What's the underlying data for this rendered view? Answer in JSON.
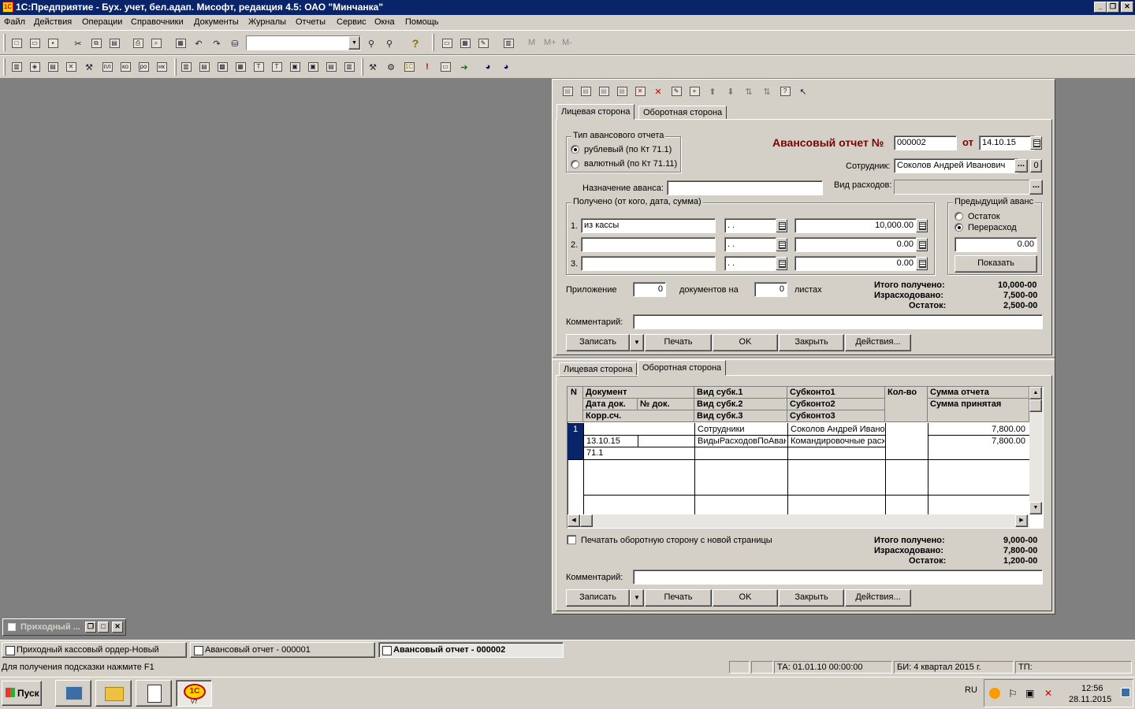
{
  "window": {
    "title": "1С:Предприятие - Бух. учет, бел.адап. Мисофт, редакция 4.5: ОАО \"Минчанка\""
  },
  "menu": [
    "Файл",
    "Действия",
    "Операции",
    "Справочники",
    "Документы",
    "Журналы",
    "Отчеты",
    "Сервис",
    "Окна",
    "Помощь"
  ],
  "toolbar": {
    "m_labels": [
      "M",
      "M+",
      "M-"
    ]
  },
  "tabs": {
    "front": "Лицевая сторона",
    "back": "Оборотная сторона"
  },
  "front": {
    "report_type": {
      "caption": "Тип авансового отчета",
      "opt1": "рублевый (по Кт 71.1)",
      "opt2": "валютный (по Кт 71.11)"
    },
    "heading": "Авансовый отчет №",
    "number": "000002",
    "from_label": "от",
    "date": "14.10.15",
    "employee_label": "Сотрудник:",
    "employee": "Соколов Андрей Иванович",
    "purpose_label": "Назначение аванса:",
    "purpose": "",
    "expense_type_label": "Вид расходов:",
    "expense_type": "",
    "received": {
      "caption": "Получено (от кого, дата, сумма)",
      "rows": [
        {
          "n": "1.",
          "from": "из кассы",
          "date": " .  .",
          "sum": "10,000.00"
        },
        {
          "n": "2.",
          "from": "",
          "date": " .  .",
          "sum": "0.00"
        },
        {
          "n": "3.",
          "from": "",
          "date": " .  .",
          "sum": "0.00"
        }
      ]
    },
    "prev": {
      "caption": "Предыдущий аванс",
      "opt1": "Остаток",
      "opt2": "Перерасход",
      "value": "0.00",
      "show_btn": "Показать"
    },
    "attach_label": "Приложение",
    "attach_docs": "0",
    "docs_label": "документов на",
    "sheets": "0",
    "sheets_label": "листах",
    "totals": {
      "received_label": "Итого получено:",
      "received": "10,000-00",
      "spent_label": "Израсходовано:",
      "spent": "7,500-00",
      "rest_label": "Остаток:",
      "rest": "2,500-00"
    },
    "comment_label": "Комментарий:",
    "comment": ""
  },
  "buttons": {
    "save": "Записать",
    "print": "Печать",
    "ok": "OK",
    "close": "Закрыть",
    "actions": "Действия..."
  },
  "back": {
    "headers": {
      "n": "N",
      "doc": "Документ",
      "doc_date": "Дата док.",
      "doc_no": "№ док.",
      "corr": "Корр.сч.",
      "sub1": "Вид субк.1",
      "sub2": "Вид субк.2",
      "sub3": "Вид субк.3",
      "subk1": "Субконто1",
      "subk2": "Субконто2",
      "subk3": "Субконто3",
      "qty": "Кол-во",
      "sum_report": "Сумма отчета",
      "sum_accepted": "Сумма принятая"
    },
    "row": {
      "n": "1",
      "doc": "",
      "date": "13.10.15",
      "no": "",
      "corr": "71.1",
      "sub1": "Сотрудники",
      "sub2": "ВидыРасходовПоАвансОтчетам",
      "sub3": "",
      "subk1": "Соколов Андрей Иванович",
      "subk2": "Командировочные расходы",
      "subk3": "",
      "qty": "",
      "sum_report": "7,800.00",
      "sum_accepted": "7,800.00"
    },
    "print_new_page": "Печатать оборотную сторону с новой страницы",
    "totals": {
      "received_label": "Итого получено:",
      "received": "9,000-00",
      "spent_label": "Израсходовано:",
      "spent": "7,800-00",
      "rest_label": "Остаток:",
      "rest": "1,200-00"
    },
    "comment_label": "Комментарий:",
    "comment": ""
  },
  "minimized": {
    "title": "Приходный ..."
  },
  "window_list": [
    "Приходный кассовый ордер-Новый",
    "Авансовый отчет - 000001",
    "Авансовый отчет - 000002"
  ],
  "status": {
    "hint": "Для получения подсказки нажмите F1",
    "ta": "ТА: 01.01.10  00:00:00",
    "bi": "БИ: 4 квартал 2015 г.",
    "tp": "ТП:"
  },
  "taskbar": {
    "start": "Пуск",
    "lang": "RU",
    "time": "12:56",
    "date": "28.11.2015",
    "v7": "V7"
  }
}
